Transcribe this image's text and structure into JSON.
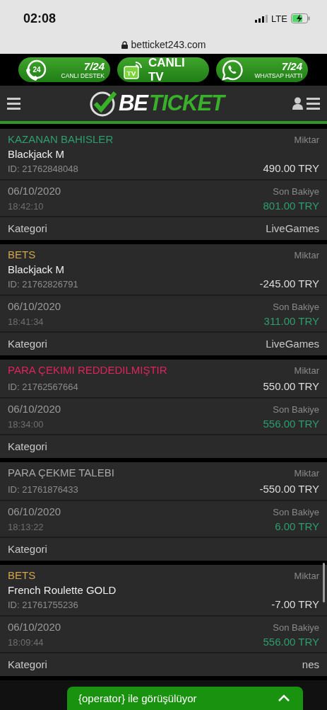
{
  "status_bar": {
    "time": "02:08",
    "network": "LTE"
  },
  "address_bar": {
    "url": "betticket243.com"
  },
  "promo_buttons": [
    {
      "kind": "support",
      "icon_text": "24",
      "top": "7/24",
      "bottom": "CANLI DESTEK"
    },
    {
      "kind": "tv",
      "icon_text": "TV",
      "label": "CANLI TV"
    },
    {
      "kind": "whatsapp",
      "top": "7/24",
      "bottom": "WHATSAP HATTI"
    }
  ],
  "header": {
    "logo_white": "BE",
    "logo_green": "TICKET"
  },
  "transactions": [
    {
      "title": "KAZANAN BAHISLER",
      "color": "#2e9e6e",
      "name": "Blackjack M",
      "id": "ID: 21762848048",
      "amount_label": "Miktar",
      "amount": "490.00 TRY",
      "date": "06/10/2020",
      "time": "18:42:10",
      "balance_label": "Son Bakiye",
      "balance": "801.00 TRY",
      "category_label": "Kategori",
      "category": "LiveGames"
    },
    {
      "title": "BETS",
      "color": "#d2a64c",
      "name": "Blackjack M",
      "id": "ID: 21762826791",
      "amount_label": "Miktar",
      "amount": "-245.00 TRY",
      "date": "06/10/2020",
      "time": "18:41:34",
      "balance_label": "Son Bakiye",
      "balance": "311.00 TRY",
      "category_label": "Kategori",
      "category": "LiveGames"
    },
    {
      "title": "PARA ÇEKIMI REDDEDILMIŞTIR",
      "color": "#e0245e",
      "id": "ID: 21762567664",
      "amount_label": "Miktar",
      "amount": "550.00 TRY",
      "date": "06/10/2020",
      "time": "18:34:00",
      "balance_label": "Son Bakiye",
      "balance": "556.00 TRY",
      "category_label": "Kategori"
    },
    {
      "title": "PARA ÇEKME TALEBI",
      "color": "#a8a8a8",
      "id": "ID: 21761876433",
      "amount_label": "Miktar",
      "amount": "-550.00 TRY",
      "date": "06/10/2020",
      "time": "18:13:22",
      "balance_label": "Son Bakiye",
      "balance": "6.00 TRY",
      "category_label": "Kategori"
    },
    {
      "title": "BETS",
      "color": "#d2a64c",
      "name": "French Roulette GOLD",
      "id": "ID: 21761755236",
      "amount_label": "Miktar",
      "amount": "-7.00 TRY",
      "date": "06/10/2020",
      "time": "18:09:44",
      "balance_label": "Son Bakiye",
      "balance": "556.00 TRY",
      "category_label": "Kategori",
      "category": "nes"
    }
  ],
  "chat_bar": {
    "text": "{operator} ile görüşülüyor"
  }
}
